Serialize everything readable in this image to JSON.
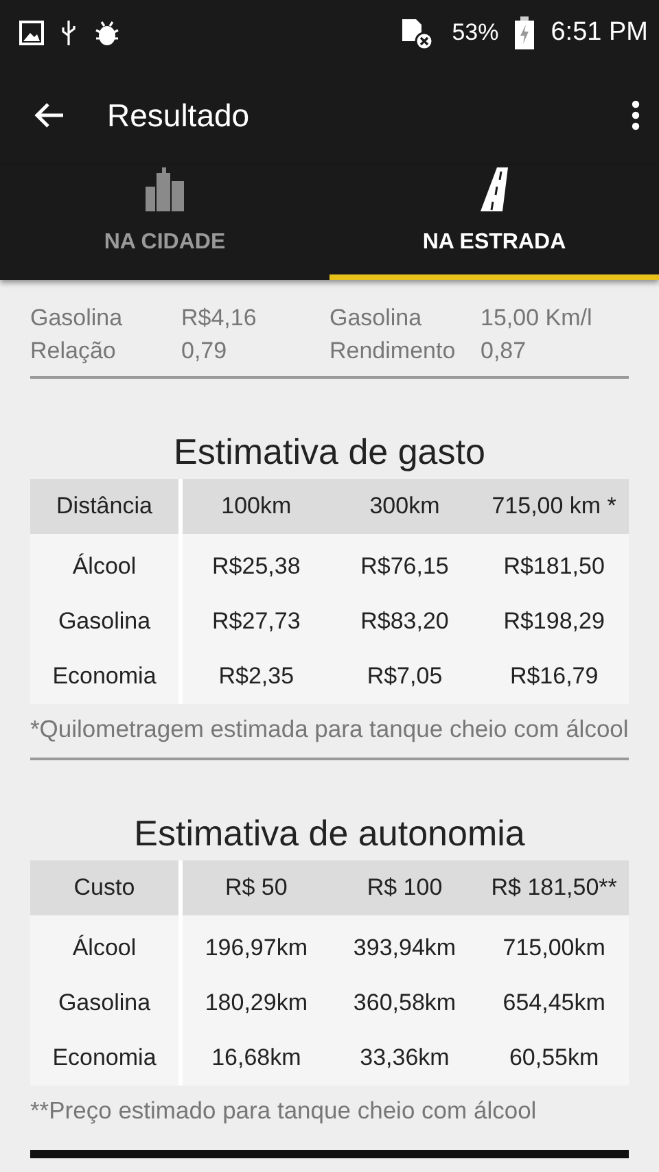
{
  "status_bar": {
    "battery": "53%",
    "time": "6:51 PM"
  },
  "toolbar": {
    "title": "Resultado"
  },
  "tabs": [
    {
      "label": "NA CIDADE",
      "kind": "city",
      "selected": false
    },
    {
      "label": "NA ESTRADA",
      "kind": "road",
      "selected": true
    }
  ],
  "summary": {
    "left": [
      {
        "label": "Gasolina",
        "value": "R$4,16"
      },
      {
        "label": "Relação",
        "value": "0,79"
      }
    ],
    "right": [
      {
        "label": "Gasolina",
        "value": "15,00 Km/l"
      },
      {
        "label": "Rendimento",
        "value": "0,87"
      }
    ]
  },
  "sections": [
    {
      "title": "Estimativa de gasto",
      "columns": [
        "Distância",
        "100km",
        "300km",
        "715,00 km *"
      ],
      "rows": [
        [
          "Álcool",
          "R$25,38",
          "R$76,15",
          "R$181,50"
        ],
        [
          "Gasolina",
          "R$27,73",
          "R$83,20",
          "R$198,29"
        ],
        [
          "Economia",
          "R$2,35",
          "R$7,05",
          "R$16,79"
        ]
      ],
      "note": "*Quilometragem estimada para tanque cheio com álcool"
    },
    {
      "title": "Estimativa de autonomia",
      "columns": [
        "Custo",
        "R$ 50",
        "R$ 100",
        "R$ 181,50**"
      ],
      "rows": [
        [
          "Álcool",
          "196,97km",
          "393,94km",
          "715,00km"
        ],
        [
          "Gasolina",
          "180,29km",
          "360,58km",
          "654,45km"
        ],
        [
          "Economia",
          "16,68km",
          "33,36km",
          "60,55km"
        ]
      ],
      "note": "**Preço estimado para tanque cheio com álcool"
    }
  ]
}
